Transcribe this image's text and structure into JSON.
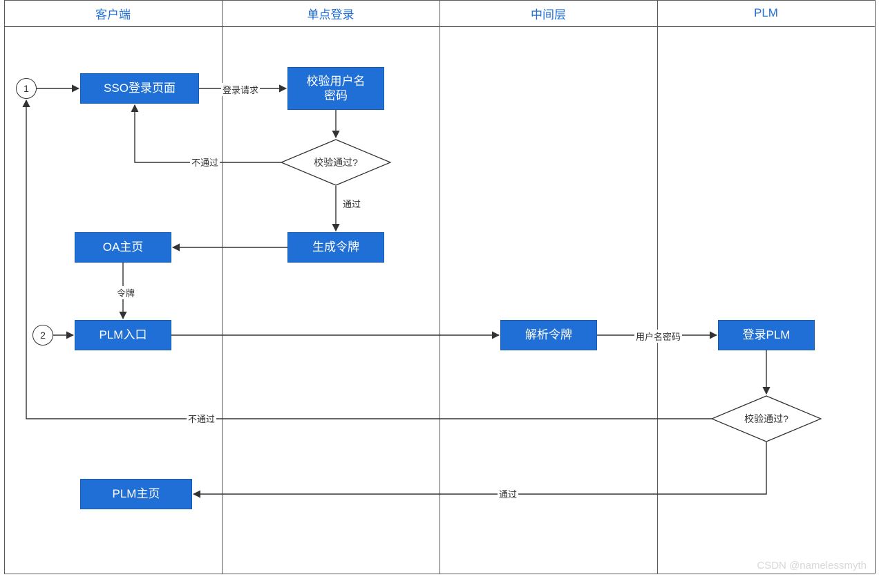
{
  "lanes": {
    "client": "客户端",
    "sso": "单点登录",
    "middle": "中间层",
    "plm": "PLM"
  },
  "circles": {
    "c1": "1",
    "c2": "2"
  },
  "nodes": {
    "ssoLoginPage": "SSO登录页面",
    "validateUserPwd": "校验用户名\n密码",
    "genToken": "生成令牌",
    "oaHome": "OA主页",
    "plmEntry": "PLM入口",
    "parseToken": "解析令牌",
    "loginPlm": "登录PLM",
    "plmHome": "PLM主页"
  },
  "decisions": {
    "d1": "校验通过?",
    "d2": "校验通过?"
  },
  "edgeLabels": {
    "loginReq": "登录请求",
    "fail1": "不通过",
    "pass1": "通过",
    "token": "令牌",
    "userPwd": "用户名密码",
    "fail2": "不通过",
    "pass2": "通过"
  },
  "watermark": "CSDN @namelessmyth"
}
